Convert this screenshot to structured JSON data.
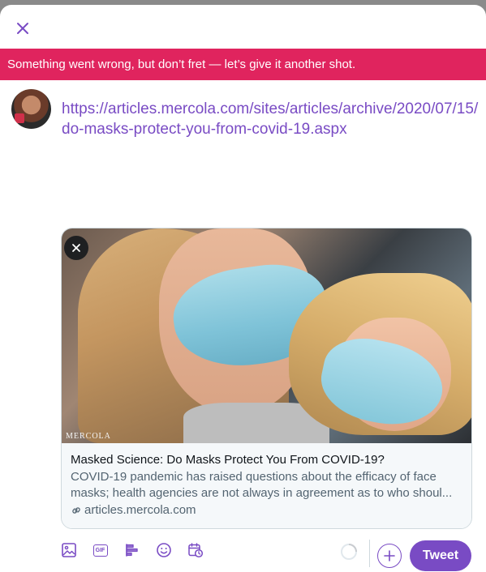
{
  "error_banner": {
    "text": "Something went wrong, but don’t fret — let’s give it another shot."
  },
  "composer": {
    "text": "https://articles.mercola.com/sites/articles/archive/2020/07/15/do-masks-protect-you-from-covid-19.aspx"
  },
  "link_card": {
    "image_watermark": "MERCOLA",
    "title": "Masked Science: Do Masks Protect You From COVID-19?",
    "description_line1": "COVID-19 pandemic has raised questions about the efficacy of face",
    "description_line2": "masks; health agencies are not always in agreement as to who shoul...",
    "domain": "articles.mercola.com"
  },
  "toolbar": {
    "gif_label": "GIF",
    "tweet_label": "Tweet"
  },
  "icons": {
    "close": "close-icon",
    "media": "image-icon",
    "gif": "gif-icon",
    "poll": "poll-icon",
    "emoji": "emoji-icon",
    "schedule": "schedule-icon",
    "link": "link-icon",
    "add": "plus-icon"
  },
  "colors": {
    "accent": "#794bc4",
    "error": "#e0245e"
  }
}
